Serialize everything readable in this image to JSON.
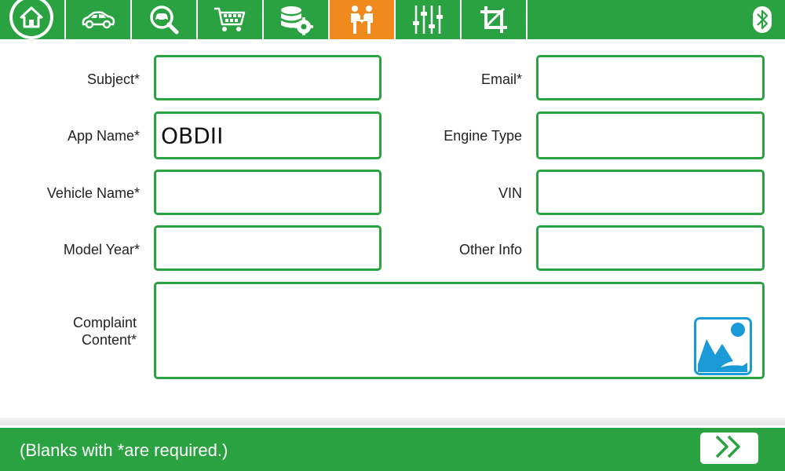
{
  "toolbar": {
    "tabs": [
      {
        "icon": "home-icon"
      },
      {
        "icon": "car-icon"
      },
      {
        "icon": "vehicle-search-icon"
      },
      {
        "icon": "shopping-cart-icon"
      },
      {
        "icon": "database-settings-icon"
      },
      {
        "icon": "feedback-people-icon",
        "active": true
      },
      {
        "icon": "sliders-icon"
      },
      {
        "icon": "crop-icon"
      }
    ],
    "bluetooth_icon": "bluetooth-icon"
  },
  "form": {
    "subject": {
      "label": "Subject*",
      "value": ""
    },
    "email": {
      "label": "Email*",
      "value": ""
    },
    "app_name": {
      "label": "App Name*",
      "value": "OBDII"
    },
    "engine_type": {
      "label": "Engine Type",
      "value": ""
    },
    "vehicle_name": {
      "label": "Vehicle Name*",
      "value": ""
    },
    "vin": {
      "label": "VIN",
      "value": ""
    },
    "model_year": {
      "label": "Model Year*",
      "value": ""
    },
    "other_info": {
      "label": "Other Info",
      "value": ""
    },
    "complaint": {
      "label_line1": "Complaint",
      "label_line2": "Content*",
      "value": ""
    }
  },
  "footer": {
    "hint": "(Blanks with *are required.)"
  },
  "colors": {
    "primary": "#2aa241",
    "active_tab": "#f08a1c",
    "image_icon": "#1a9ad6"
  }
}
